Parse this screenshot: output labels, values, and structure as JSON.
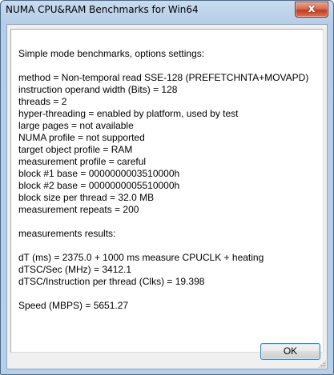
{
  "window": {
    "title": "NUMA CPU&RAM Benchmarks for Win64",
    "close_glyph": "x",
    "close_icon": "close-icon"
  },
  "report": {
    "lines": [
      "Simple mode benchmarks, options settings:",
      "",
      "method = Non-temporal read SSE-128 (PREFETCHNTA+MOVAPD)",
      "instruction operand width (Bits) = 128",
      "threads = 2",
      "hyper-threading = enabled by platform, used by test",
      "large pages = not available",
      "NUMA profile = not supported",
      "target object profile = RAM",
      "measurement profile = careful",
      "block #1 base = 0000000003510000h",
      "block #2 base = 0000000005510000h",
      "block size per thread = 32.0 MB",
      "measurement repeats = 200",
      "",
      "measurements results:",
      "",
      "dT (ms) = 2375.0  + 1000 ms measure CPUCLK + heating",
      "dTSC/Sec (MHz) = 3412.1",
      "dTSC/Instruction per thread (Clks) = 19.398",
      "",
      "Speed (MBPS) = 5651.27"
    ]
  },
  "buttons": {
    "ok_label": "OK"
  }
}
